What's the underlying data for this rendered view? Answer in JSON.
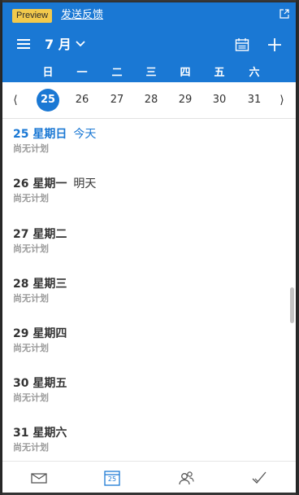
{
  "header": {
    "badge": "Preview",
    "feedback_link": "发送反馈",
    "month_label": "7 月",
    "icons": [
      "popout-icon",
      "hamburger-menu-icon",
      "chevron-down-icon",
      "calendar-icon",
      "plus-icon"
    ]
  },
  "weekdays": [
    "日",
    "一",
    "二",
    "三",
    "四",
    "五",
    "六"
  ],
  "week_strip": {
    "prev": "⟨",
    "next": "⟩",
    "days": [
      "25",
      "26",
      "27",
      "28",
      "29",
      "30",
      "31"
    ],
    "selected": "25"
  },
  "agenda": [
    {
      "date": "25 星期日",
      "relative": "今天",
      "status": "尚无计划"
    },
    {
      "date": "26 星期一",
      "relative": "明天",
      "status": "尚无计划"
    },
    {
      "date": "27 星期二",
      "relative": "",
      "status": "尚无计划"
    },
    {
      "date": "28 星期三",
      "relative": "",
      "status": "尚无计划"
    },
    {
      "date": "29 星期四",
      "relative": "",
      "status": "尚无计划"
    },
    {
      "date": "30 星期五",
      "relative": "",
      "status": "尚无计划"
    },
    {
      "date": "31 星期六",
      "relative": "",
      "status": "尚无计划"
    }
  ],
  "bottom_nav": {
    "calendar_day": "25",
    "icons": [
      "mail-icon",
      "calendar-icon",
      "people-icon",
      "todo-check-icon"
    ]
  },
  "colors": {
    "accent": "#1a78d4",
    "badge": "#f2c94c",
    "muted_text": "#9a9a9a"
  }
}
